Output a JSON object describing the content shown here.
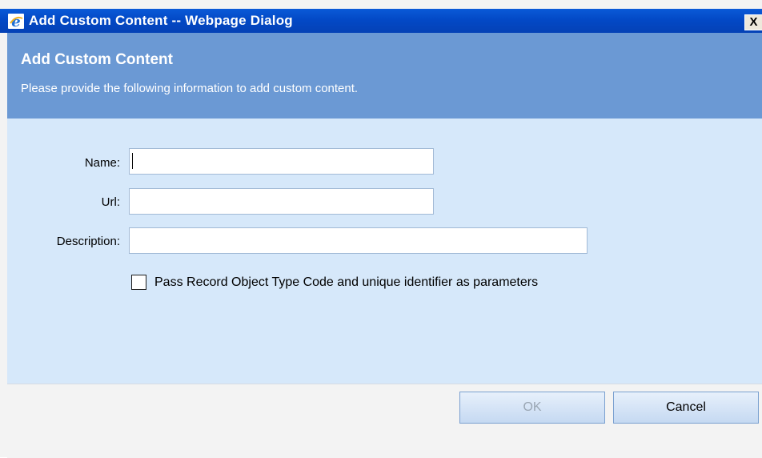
{
  "window": {
    "title": "Add Custom Content -- Webpage Dialog",
    "icon": "ie-icon",
    "close_label": "X"
  },
  "header": {
    "title": "Add Custom Content",
    "subtitle": "Please provide the following information to add custom content."
  },
  "form": {
    "name_label": "Name:",
    "name_value": "",
    "url_label": "Url:",
    "url_value": "",
    "description_label": "Description:",
    "description_value": "",
    "pass_params_label": "Pass Record Object Type Code and unique identifier as parameters",
    "pass_params_checked": false
  },
  "footer": {
    "ok_label": "OK",
    "ok_enabled": false,
    "cancel_label": "Cancel"
  },
  "colors": {
    "titlebar": "#0349c6",
    "header": "#6b99d4",
    "content": "#d6e8fa",
    "footer": "#f3f3f3"
  }
}
